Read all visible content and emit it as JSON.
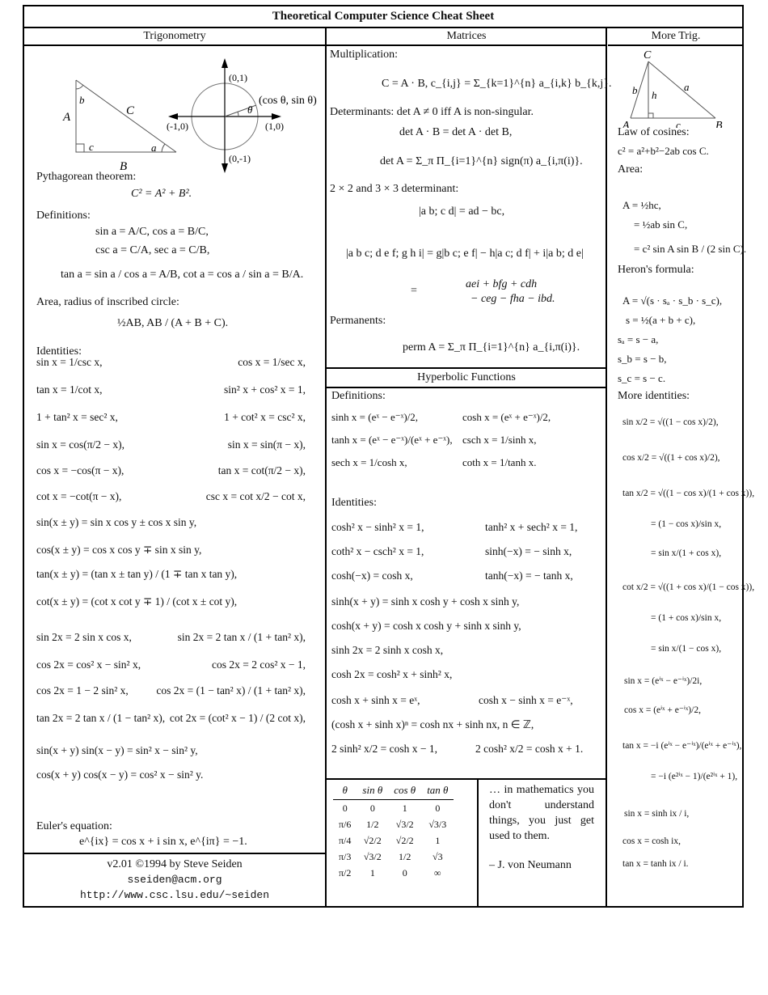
{
  "title": "Theoretical Computer Science Cheat Sheet",
  "columns": {
    "trig": "Trigonometry",
    "matrices": "Matrices",
    "more_trig": "More Trig.",
    "hyperbolic": "Hyperbolic Functions"
  },
  "diagram": {
    "triangle_labels": {
      "A": "A",
      "B": "B",
      "C": "C",
      "a": "a",
      "b": "b",
      "c": "c"
    },
    "circle_labels": {
      "top": "(0,1)",
      "bottom": "(0,-1)",
      "left": "(-1,0)",
      "right": "(1,0)",
      "point": "(cos θ, sin θ)",
      "angle": "θ"
    }
  },
  "trig": {
    "pyth_label": "Pythagorean theorem:",
    "pyth": "C² = A² + B².",
    "defs_label": "Definitions:",
    "defs": [
      "sin a = A/C,    cos a = B/C,",
      "csc a = C/A,    sec a = C/B,",
      "tan a = sin a / cos a = A/B,    cot a = cos a / sin a = B/A."
    ],
    "area_label": "Area, radius of inscribed circle:",
    "area": "½AB,    AB / (A + B + C).",
    "ident_label": "Identities:",
    "identities": [
      [
        "sin x = 1/csc x,",
        "cos x = 1/sec x,"
      ],
      [
        "tan x = 1/cot x,",
        "sin² x + cos² x = 1,"
      ],
      [
        "1 + tan² x = sec² x,",
        "1 + cot² x = csc² x,"
      ],
      [
        "sin x = cos(π/2 − x),",
        "sin x = sin(π − x),"
      ],
      [
        "cos x = −cos(π − x),",
        "tan x = cot(π/2 − x),"
      ],
      [
        "cot x = −cot(π − x),",
        "csc x = cot x/2 − cot x,"
      ],
      [
        "sin(x ± y) = sin x cos y ± cos x sin y,",
        ""
      ],
      [
        "cos(x ± y) = cos x cos y ∓ sin x sin y,",
        ""
      ],
      [
        "tan(x ± y) = (tan x ± tan y) / (1 ∓ tan x tan y),",
        ""
      ],
      [
        "cot(x ± y) = (cot x cot y ∓ 1) / (cot x ± cot y),",
        ""
      ],
      [
        "sin 2x = 2 sin x cos x,",
        "sin 2x = 2 tan x / (1 + tan² x),"
      ],
      [
        "cos 2x = cos² x − sin² x,",
        "cos 2x = 2 cos² x − 1,"
      ],
      [
        "cos 2x = 1 − 2 sin² x,",
        "cos 2x = (1 − tan² x) / (1 + tan² x),"
      ],
      [
        "tan 2x = 2 tan x / (1 − tan² x),",
        "cot 2x = (cot² x − 1) / (2 cot x),"
      ],
      [
        "sin(x + y) sin(x − y) = sin² x − sin² y,",
        ""
      ],
      [
        "cos(x + y) cos(x − y) = cos² x − sin² y.",
        ""
      ]
    ],
    "euler_label": "Euler's equation:",
    "euler": "eⁱˣ = cos x + i sin x,        eⁱᵖ = −1.",
    "euler_display": "e^{ix} = cos x + i sin x,        e^{iπ} = −1."
  },
  "footer": {
    "version": "v2.01 ©1994 by Steve Seiden",
    "email": "sseiden@acm.org",
    "url": "http://www.csc.lsu.edu/~seiden"
  },
  "matrices": {
    "mult_label": "Multiplication:",
    "mult": "C = A · B,    c_{i,j} = Σ_{k=1}^{n} a_{i,k} b_{k,j}.",
    "det_label": "Determinants: det A ≠ 0 iff A is non-singular.",
    "det1": "det A · B = det A · det B,",
    "det2": "det A = Σ_π Π_{i=1}^{n} sign(π) a_{i,π(i)}.",
    "det23_label": "2 × 2 and 3 × 3 determinant:",
    "det2x2": "|a b; c d| = ad − bc,",
    "det3x3": "|a b c; d e f; g h i| = g|b c; e f| − h|a c; d f| + i|a b; d e|",
    "det3x3_expand1": "aei + bfg + cdh",
    "det3x3_expand2": "− ceg − fha − ibd.",
    "perm_label": "Permanents:",
    "perm": "perm A = Σ_π Π_{i=1}^{n} a_{i,π(i)}."
  },
  "hyperbolic": {
    "defs_label": "Definitions:",
    "defs": [
      [
        "sinh x = (eˣ − e⁻ˣ)/2,",
        "cosh x = (eˣ + e⁻ˣ)/2,"
      ],
      [
        "tanh x = (eˣ − e⁻ˣ)/(eˣ + e⁻ˣ),",
        "csch x = 1/sinh x,"
      ],
      [
        "sech x = 1/cosh x,",
        "coth x = 1/tanh x."
      ]
    ],
    "ident_label": "Identities:",
    "identities": [
      [
        "cosh² x − sinh² x = 1,",
        "tanh² x + sech² x = 1,"
      ],
      [
        "coth² x − csch² x = 1,",
        "sinh(−x) = − sinh x,"
      ],
      [
        "cosh(−x) = cosh x,",
        "tanh(−x) = − tanh x,"
      ],
      [
        "sinh(x + y) = sinh x cosh y + cosh x sinh y,",
        ""
      ],
      [
        "cosh(x + y) = cosh x cosh y + sinh x sinh y,",
        ""
      ],
      [
        "sinh 2x = 2 sinh x cosh x,",
        ""
      ],
      [
        "cosh 2x = cosh² x + sinh² x,",
        ""
      ],
      [
        "cosh x + sinh x = eˣ,",
        "cosh x − sinh x = e⁻ˣ,"
      ],
      [
        "(cosh x + sinh x)ⁿ = cosh nx + sinh nx,    n ∈ ℤ,",
        ""
      ],
      [
        "2 sinh² x/2 = cosh x − 1,",
        "2 cosh² x/2 = cosh x + 1."
      ]
    ]
  },
  "trig_table": {
    "headers": [
      "θ",
      "sin θ",
      "cos θ",
      "tan θ"
    ],
    "rows": [
      [
        "0",
        "0",
        "1",
        "0"
      ],
      [
        "π/6",
        "1/2",
        "√3/2",
        "√3/3"
      ],
      [
        "π/4",
        "√2/2",
        "√2/2",
        "1"
      ],
      [
        "π/3",
        "√3/2",
        "1/2",
        "√3"
      ],
      [
        "π/2",
        "1",
        "0",
        "∞"
      ]
    ]
  },
  "quote": {
    "text": "… in mathematics you don't understand things, you just get used to them.",
    "author": "– J. von Neumann"
  },
  "more_trig": {
    "tri_labels": {
      "A": "A",
      "B": "B",
      "C": "C",
      "a": "a",
      "b": "b",
      "c": "c",
      "h": "h"
    },
    "cos_law_label": "Law of cosines:",
    "cos_law": "c² = a²+b²−2ab cos C.",
    "area_label": "Area:",
    "area": [
      "A = ½hc,",
      "= ½ab sin C,",
      "= c² sin A sin B / (2 sin C)."
    ],
    "heron_label": "Heron's formula:",
    "heron": [
      "A = √(s · sₐ · s_b · s_c),",
      "s = ½(a + b + c),",
      "sₐ = s − a,",
      "s_b = s − b,",
      "s_c = s − c."
    ],
    "more_label": "More identities:",
    "more": [
      "sin x/2 = √((1 − cos x)/2),",
      "cos x/2 = √((1 + cos x)/2),",
      "tan x/2 = √((1 − cos x)/(1 + cos x)),",
      "= (1 − cos x)/sin x,",
      "= sin x/(1 + cos x),",
      "cot x/2 = √((1 + cos x)/(1 − cos x)),",
      "= (1 + cos x)/sin x,",
      "= sin x/(1 − cos x),",
      "sin x = (eⁱˣ − e⁻ⁱˣ)/2i,",
      "cos x = (eⁱˣ + e⁻ⁱˣ)/2,",
      "tan x = −i (eⁱˣ − e⁻ⁱˣ)/(eⁱˣ + e⁻ⁱˣ),",
      "= −i (e²ⁱˣ − 1)/(e²ⁱˣ + 1),",
      "sin x = sinh ix / i,",
      "cos x = cosh ix,",
      "tan x = tanh ix / i."
    ]
  }
}
